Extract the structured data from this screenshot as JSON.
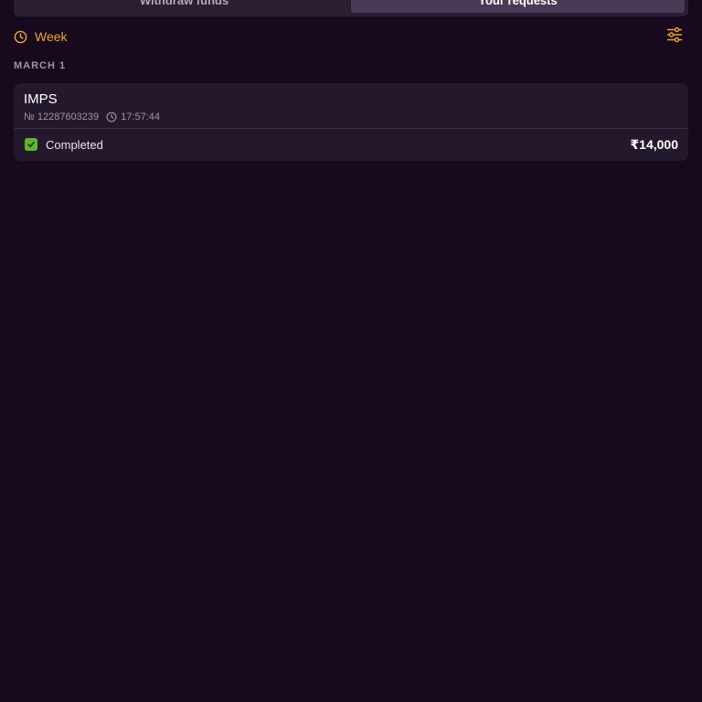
{
  "tabs": [
    {
      "label": "Withdraw funds",
      "active": false
    },
    {
      "label": "Your requests",
      "active": true
    }
  ],
  "filter": {
    "period_label": "Week",
    "period_icon": "clock-icon",
    "filter_icon": "sliders-icon",
    "accent_color": "#f0a532"
  },
  "groups": [
    {
      "date_label": "MARCH 1",
      "transactions": [
        {
          "method": "IMPS",
          "number": "№ 12287603239",
          "time": "17:57:44",
          "status": "Completed",
          "status_color": "#5eb52f",
          "amount": "₹14,000"
        }
      ]
    }
  ]
}
